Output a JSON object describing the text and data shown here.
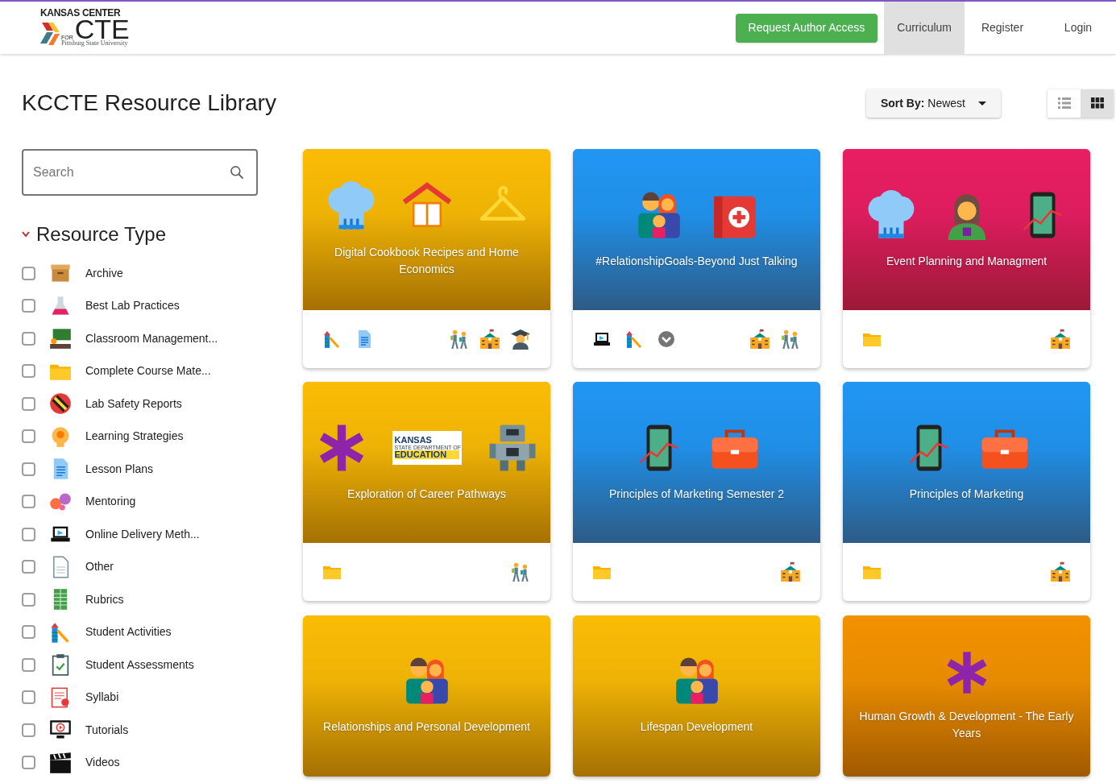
{
  "logo": {
    "line1": "KANSAS CENTER",
    "line2": "FOR",
    "line3": "CTE",
    "line4": "Pittsburg State University"
  },
  "nav": [
    {
      "label": "Request Author Access",
      "kind": "cta",
      "selected": false
    },
    {
      "label": "Curriculum",
      "kind": "link",
      "selected": true
    },
    {
      "label": "Register",
      "kind": "link",
      "selected": false
    },
    {
      "label": "Login",
      "kind": "link",
      "selected": false
    }
  ],
  "page_title": "KCCTE Resource Library",
  "sort": {
    "label": "Sort By:",
    "value": "Newest"
  },
  "view_toggle": [
    {
      "kind": "list",
      "selected": false
    },
    {
      "kind": "grid",
      "selected": true
    }
  ],
  "search": {
    "placeholder": "Search"
  },
  "filter": {
    "title": "Resource Type",
    "expanded": true,
    "items": [
      {
        "label": "Archive",
        "checked": false
      },
      {
        "label": "Best Lab Practices",
        "checked": false
      },
      {
        "label": "Classroom Management...",
        "checked": false
      },
      {
        "label": "Complete Course Mate...",
        "checked": false
      },
      {
        "label": "Lab Safety Reports",
        "checked": false
      },
      {
        "label": "Learning Strategies",
        "checked": false
      },
      {
        "label": "Lesson Plans",
        "checked": false
      },
      {
        "label": "Mentoring",
        "checked": false
      },
      {
        "label": "Online Delivery Meth...",
        "checked": false
      },
      {
        "label": "Other",
        "checked": false
      },
      {
        "label": "Rubrics",
        "checked": false
      },
      {
        "label": "Student Activities",
        "checked": false
      },
      {
        "label": "Student Assessments",
        "checked": false
      },
      {
        "label": "Syllabi",
        "checked": false
      },
      {
        "label": "Tutorials",
        "checked": false
      },
      {
        "label": "Videos",
        "checked": false
      }
    ]
  },
  "cards": [
    {
      "title": "Digital Cookbook Recipes and Home Economics",
      "color": "#fbbc05"
    },
    {
      "title": "#RelationshipGoals-Beyond Just Talking",
      "color": "#2196f3"
    },
    {
      "title": "Event Planning and Managment",
      "color": "#e91e63"
    },
    {
      "title": "Exploration of Career Pathways",
      "color": "#fbbc05",
      "kansas_logo": {
        "line1": "KANSAS",
        "line2": "STATE DEPARTMENT OF",
        "line3": "EDUCATION"
      }
    },
    {
      "title": "Principles of Marketing Semester 2",
      "color": "#2196f3"
    },
    {
      "title": "Principles of Marketing",
      "color": "#2196f3"
    },
    {
      "title": "Relationships and Personal Development",
      "color": "#fbbc05"
    },
    {
      "title": "Lifespan Development",
      "color": "#fbbc05"
    },
    {
      "title": "Human Growth & Development - The Early Years",
      "color": "#f39200"
    }
  ]
}
